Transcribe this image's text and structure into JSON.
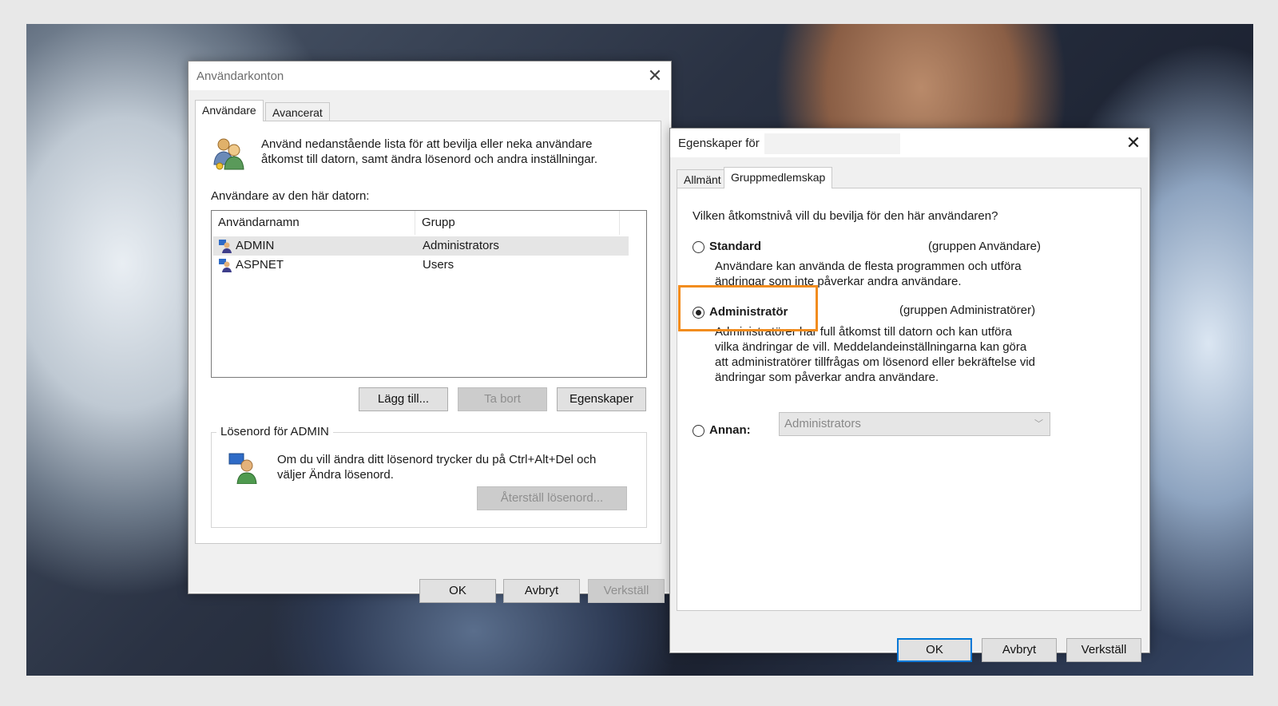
{
  "user_accounts": {
    "title": "Användarkonton",
    "tabs": [
      "Användare",
      "Avancerat"
    ],
    "intro": [
      "Använd nedanstående lista för att bevilja eller neka användare",
      "åtkomst till datorn, samt ändra lösenord och andra inställningar."
    ],
    "users_label": "Användare av den här datorn:",
    "columns": [
      "Användarnamn",
      "Grupp"
    ],
    "rows": [
      {
        "name": "ADMIN",
        "group": "Administrators"
      },
      {
        "name": "ASPNET",
        "group": "Users"
      }
    ],
    "add_label": "Lägg till...",
    "remove_label": "Ta bort",
    "properties_label": "Egenskaper",
    "password_group_title": "Lösenord för ADMIN",
    "password_text": [
      "Om du vill ändra ditt lösenord trycker du på Ctrl+Alt+Del och",
      "väljer Ändra lösenord."
    ],
    "reset_password_label": "Återställ lösenord...",
    "ok_label": "OK",
    "cancel_label": "Avbryt",
    "apply_label": "Verkställ"
  },
  "properties": {
    "title": "Egenskaper för",
    "tabs": [
      "Allmänt",
      "Gruppmedlemskap"
    ],
    "question": "Vilken åtkomstnivå vill du bevilja för den här användaren?",
    "standard_label": "Standard",
    "standard_group": "(gruppen Användare)",
    "standard_desc": [
      "Användare kan använda de flesta programmen och utföra",
      "ändringar som inte påverkar andra användare."
    ],
    "admin_label": "Administratör",
    "admin_group": "(gruppen Administratörer)",
    "admin_desc": [
      "Administratörer har full åtkomst till datorn och kan utföra",
      "vilka ändringar de vill. Meddelandeinställningarna kan göra",
      "att administratörer tillfrågas om lösenord eller bekräftelse vid",
      "ändringar som påverkar andra användare."
    ],
    "other_label": "Annan:",
    "other_value": "Administrators",
    "selected": "admin",
    "ok_label": "OK",
    "cancel_label": "Avbryt",
    "apply_label": "Verkställ"
  },
  "colors": {
    "highlight": "#f28c1e",
    "focus": "#0078d7"
  }
}
